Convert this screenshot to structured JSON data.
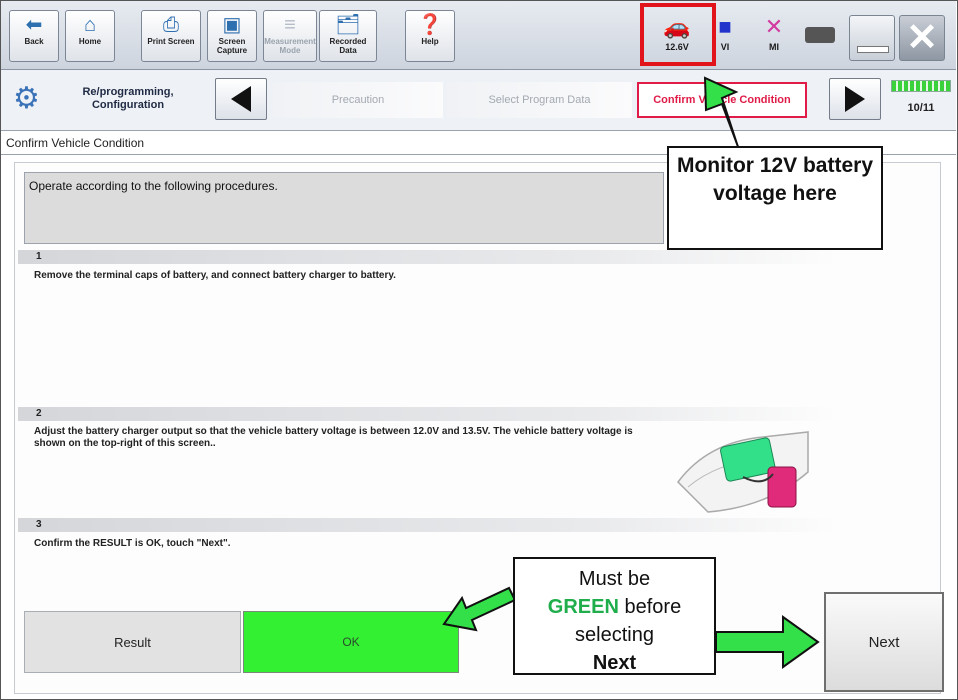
{
  "toolbar": {
    "buttons": [
      {
        "label": "Back",
        "icon": "back-arrow-icon"
      },
      {
        "label": "Home",
        "icon": "home-icon"
      },
      {
        "label": "Print Screen",
        "icon": "printer-icon"
      },
      {
        "label": "Screen Capture",
        "icon": "camera-icon"
      },
      {
        "label": "Measurement Mode",
        "icon": "measurement-icon"
      },
      {
        "label": "Recorded Data",
        "icon": "recorded-data-icon"
      },
      {
        "label": "Help",
        "icon": "help-icon"
      }
    ],
    "status": [
      {
        "label": "12.6V",
        "icon": "car-battery-icon"
      },
      {
        "label": "VI",
        "icon": "vi-connected-icon"
      },
      {
        "label": "MI",
        "icon": "mi-disconnected-icon"
      }
    ]
  },
  "nav": {
    "mode_label": "Re/programming, Configuration",
    "steps": [
      "Precaution",
      "Select Program Data",
      "Confirm Vehicle Condition"
    ],
    "progress": "10/11",
    "progress_fraction": 0.91
  },
  "page": {
    "title": "Confirm Vehicle Condition",
    "instruction": "Operate according to the following procedures.",
    "steps": [
      {
        "num": "1",
        "text": "Remove the terminal caps of battery, and connect battery charger to battery."
      },
      {
        "num": "2",
        "text": "Adjust the battery charger output so that the vehicle battery voltage is between 12.0V and 13.5V. The vehicle battery voltage is shown on the top-right of this screen.."
      },
      {
        "num": "3",
        "text": "Confirm the RESULT is OK, touch \"Next\"."
      }
    ],
    "result_label": "Result",
    "result_value": "OK",
    "next_label": "Next"
  },
  "callouts": {
    "voltage": "Monitor 12V battery voltage here",
    "green_pre": "Must be",
    "green_word": "GREEN",
    "green_mid": "before selecting",
    "green_next": "Next"
  },
  "colors": {
    "ok_green": "#33f033",
    "highlight_red": "#e1141c",
    "callout_green": "#33e04a"
  }
}
